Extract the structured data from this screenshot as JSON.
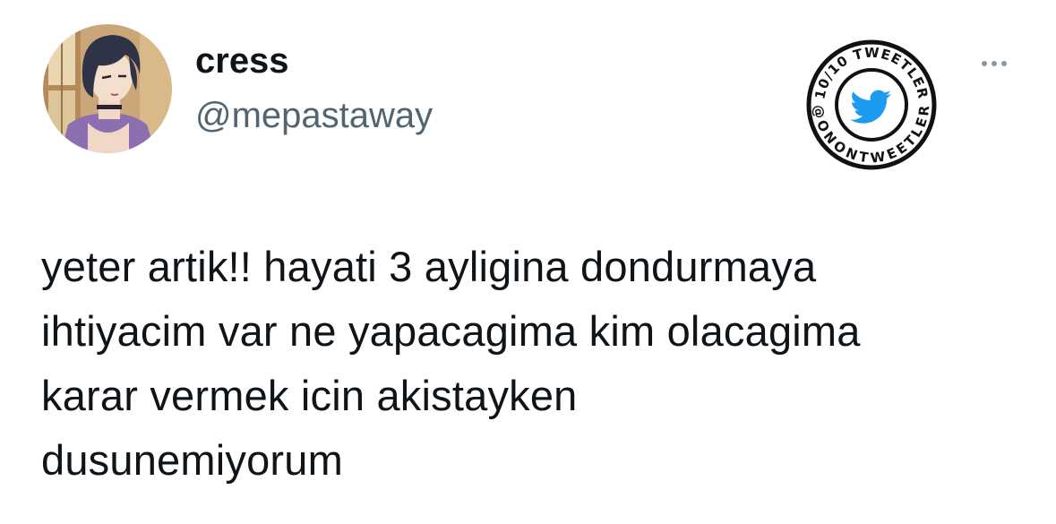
{
  "author": {
    "display_name": "cress",
    "handle": "@mepastaway"
  },
  "badge": {
    "top_text": "10/10 TWEETLER",
    "bottom_text": "@ONONTWEETLER",
    "icon": "twitter-bird-icon",
    "color": "#1d9bf0"
  },
  "menu": {
    "icon": "more-horizontal-icon"
  },
  "tweet": {
    "lines": [
      "yeter artik!! hayati 3 ayligina dondurmaya",
      "ihtiyacim var ne yapacagima kim olacagima",
      "karar vermek icin akistayken",
      "dusunemiyorum"
    ]
  },
  "colors": {
    "text": "#0f1419",
    "secondary": "#536471",
    "accent": "#1d9bf0"
  }
}
